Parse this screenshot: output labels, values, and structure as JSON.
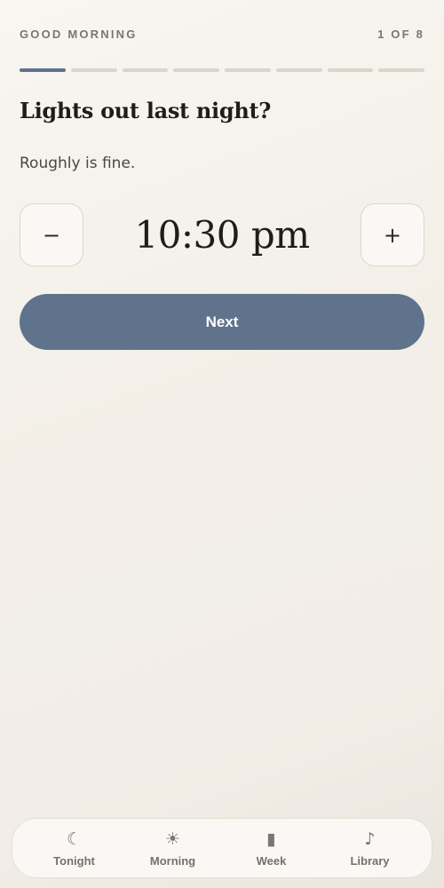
{
  "header": {
    "greeting": "GOOD MORNING",
    "step_counter": "1 OF 8"
  },
  "progress": {
    "current_step": 1,
    "total_steps": 8
  },
  "question": {
    "title": "Lights out last night?",
    "hint": "Roughly is fine."
  },
  "time_stepper": {
    "decrement_label": "−",
    "value": "10:30 pm",
    "increment_label": "+"
  },
  "next_button": {
    "label": "Next"
  },
  "tabbar": {
    "tabs": [
      {
        "label": "Tonight",
        "icon": "moon-icon",
        "glyph": "☾"
      },
      {
        "label": "Morning",
        "icon": "sun-icon",
        "glyph": "☀"
      },
      {
        "label": "Week",
        "icon": "bar-icon",
        "glyph": "▮"
      },
      {
        "label": "Library",
        "icon": "music-note-icon",
        "glyph": "♪"
      }
    ]
  },
  "colors": {
    "accent": "#5f738c",
    "background": "#f3efe8",
    "progress_inactive": "#d9d5cd"
  }
}
